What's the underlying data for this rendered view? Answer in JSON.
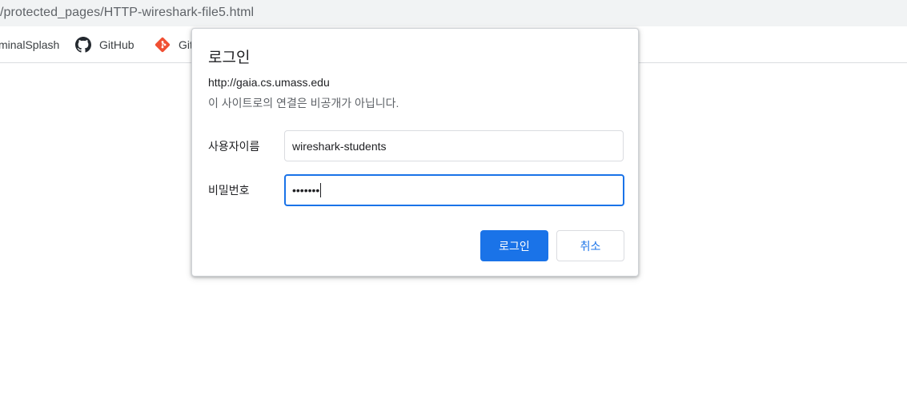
{
  "browser": {
    "url_fragment": "/protected_pages/HTTP-wireshark-file5.html",
    "bookmarks": [
      {
        "label": "minalSplash",
        "icon": "bookmark-favicon"
      },
      {
        "label": "GitHub",
        "icon": "github-icon"
      },
      {
        "label": "Git",
        "icon": "git-icon"
      }
    ]
  },
  "dialog": {
    "title": "로그인",
    "host": "http://gaia.cs.umass.edu",
    "warning": "이 사이트로의 연결은 비공개가 아닙니다.",
    "username_label": "사용자이름",
    "username_value": "wireshark-students",
    "password_label": "비밀번호",
    "password_masked": "•••••••",
    "login_button": "로그인",
    "cancel_button": "취소"
  },
  "colors": {
    "accent": "#1a73e8",
    "urlbar_bg": "#f1f3f4",
    "git_orange": "#f05033"
  }
}
